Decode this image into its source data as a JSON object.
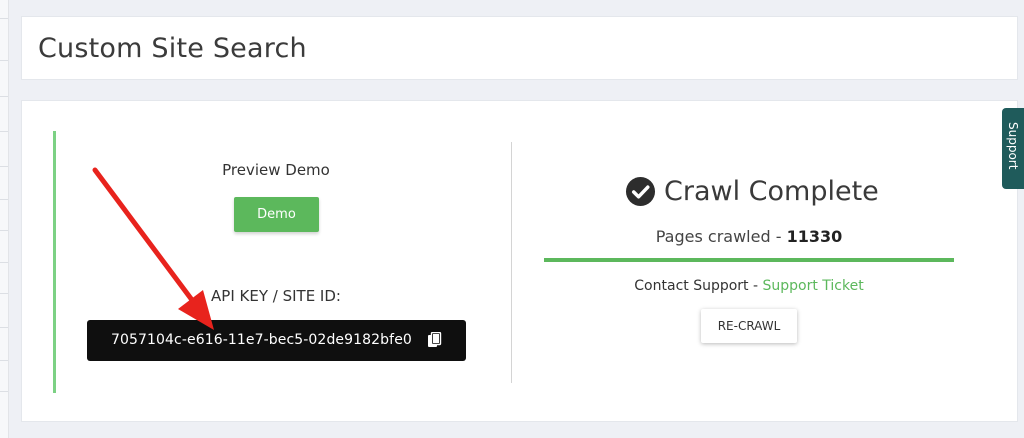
{
  "page": {
    "title": "Custom Site Search"
  },
  "preview": {
    "label": "Preview Demo",
    "demo_button_label": "Demo"
  },
  "api_key": {
    "label": "API KEY / SITE ID:",
    "value": "7057104c-e616-11e7-bec5-02de9182bfe0",
    "copy_icon": "copy-icon"
  },
  "crawl": {
    "status_icon": "check-circle-icon",
    "status_title": "Crawl Complete",
    "pages_label": "Pages crawled - ",
    "pages_count": "11330",
    "progress": 1.0,
    "progress_color": "#5cb85c",
    "contact_label": "Contact Support - ",
    "support_link_label": "Support Ticket",
    "recrawl_button_label": "RE-CRAWL"
  },
  "support_tab": {
    "label": "Support"
  },
  "colors": {
    "accent_green": "#5cb85c",
    "support_tab": "#1f5b5b",
    "annotation_arrow": "#e8231d"
  }
}
